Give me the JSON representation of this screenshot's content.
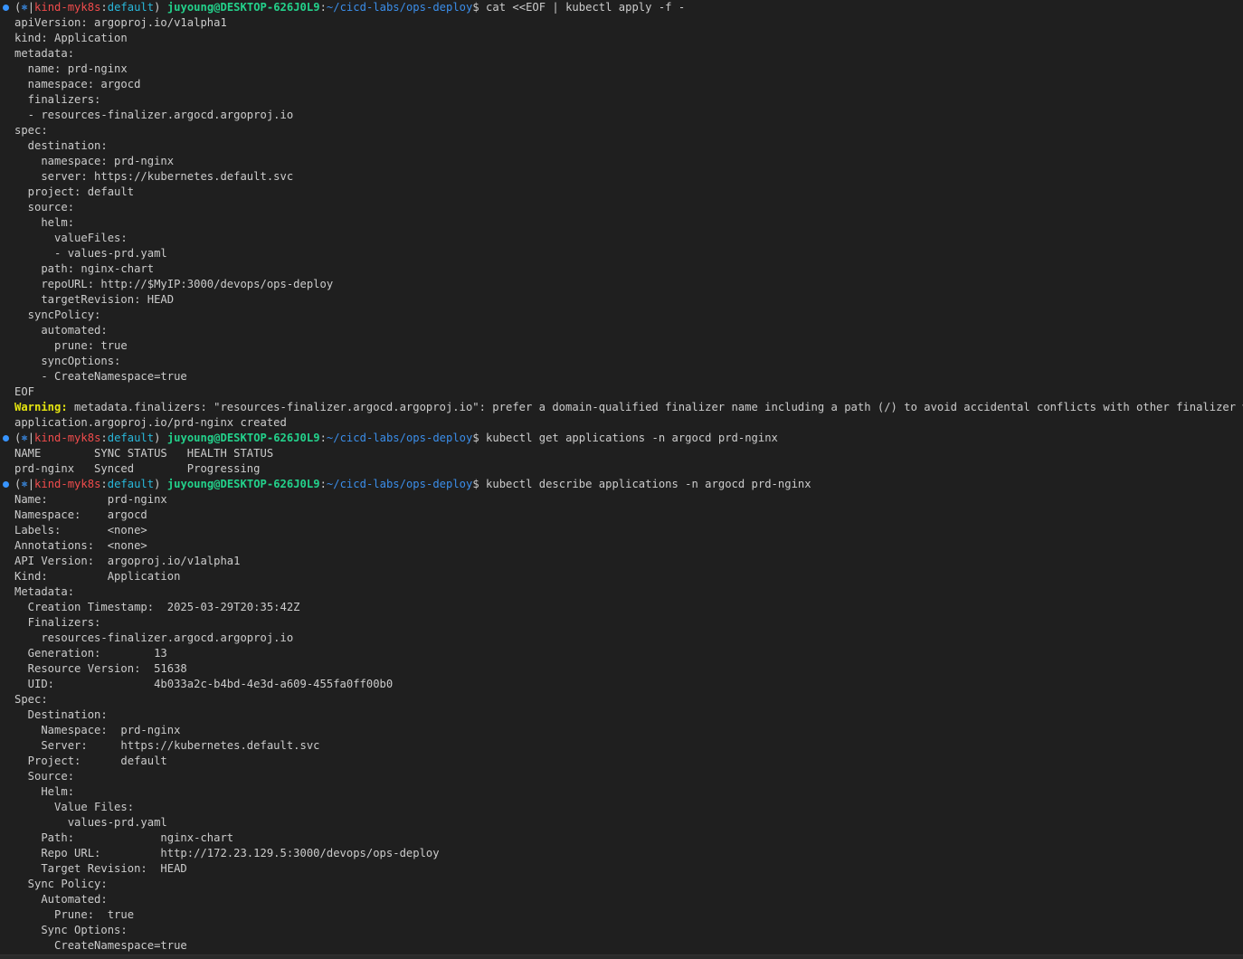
{
  "prompt": {
    "open": "(",
    "k8s_icon": "⎈",
    "sep": "|",
    "cluster": "kind-myk8s",
    "colon": ":",
    "ns": "default",
    "close": ")",
    "user_host": "juyoung@DESKTOP-626J0L9",
    "path": "~/cicd-labs/ops-deploy",
    "symbol": "$"
  },
  "blocks": [
    {
      "command": "cat <<EOF | kubectl apply -f -",
      "output": [
        {
          "text": "apiVersion: argoproj.io/v1alpha1"
        },
        {
          "text": "kind: Application"
        },
        {
          "text": "metadata:"
        },
        {
          "text": "  name: prd-nginx"
        },
        {
          "text": "  namespace: argocd"
        },
        {
          "text": "  finalizers:"
        },
        {
          "text": "  - resources-finalizer.argocd.argoproj.io"
        },
        {
          "text": "spec:"
        },
        {
          "text": "  destination:"
        },
        {
          "text": "    namespace: prd-nginx"
        },
        {
          "text": "    server: https://kubernetes.default.svc"
        },
        {
          "text": "  project: default"
        },
        {
          "text": "  source:"
        },
        {
          "text": "    helm:"
        },
        {
          "text": "      valueFiles:"
        },
        {
          "text": "      - values-prd.yaml"
        },
        {
          "text": "    path: nginx-chart"
        },
        {
          "text": "    repoURL: http://$MyIP:3000/devops/ops-deploy"
        },
        {
          "text": "    targetRevision: HEAD"
        },
        {
          "text": "  syncPolicy:"
        },
        {
          "text": "    automated:"
        },
        {
          "text": "      prune: true"
        },
        {
          "text": "    syncOptions:"
        },
        {
          "text": "    - CreateNamespace=true"
        },
        {
          "text": "EOF"
        },
        {
          "warn": "Warning:",
          "text": " metadata.finalizers: \"resources-finalizer.argocd.argoproj.io\": prefer a domain-qualified finalizer name including a path (/) to avoid accidental conflicts with other finalizer writers"
        },
        {
          "text": "application.argoproj.io/prd-nginx created"
        }
      ]
    },
    {
      "command": "kubectl get applications -n argocd prd-nginx",
      "output": [
        {
          "text": "NAME        SYNC STATUS   HEALTH STATUS"
        },
        {
          "text": "prd-nginx   Synced        Progressing"
        }
      ]
    },
    {
      "command": "kubectl describe applications -n argocd prd-nginx",
      "output": [
        {
          "text": "Name:         prd-nginx"
        },
        {
          "text": "Namespace:    argocd"
        },
        {
          "text": "Labels:       <none>"
        },
        {
          "text": "Annotations:  <none>"
        },
        {
          "text": "API Version:  argoproj.io/v1alpha1"
        },
        {
          "text": "Kind:         Application"
        },
        {
          "text": "Metadata:"
        },
        {
          "text": "  Creation Timestamp:  2025-03-29T20:35:42Z"
        },
        {
          "text": "  Finalizers:"
        },
        {
          "text": "    resources-finalizer.argocd.argoproj.io"
        },
        {
          "text": "  Generation:        13"
        },
        {
          "text": "  Resource Version:  51638"
        },
        {
          "text": "  UID:               4b033a2c-b4bd-4e3d-a609-455fa0ff00b0"
        },
        {
          "text": "Spec:"
        },
        {
          "text": "  Destination:"
        },
        {
          "text": "    Namespace:  prd-nginx"
        },
        {
          "text": "    Server:     https://kubernetes.default.svc"
        },
        {
          "text": "  Project:      default"
        },
        {
          "text": "  Source:"
        },
        {
          "text": "    Helm:"
        },
        {
          "text": "      Value Files:"
        },
        {
          "text": "        values-prd.yaml"
        },
        {
          "text": "    Path:             nginx-chart"
        },
        {
          "text": "    Repo URL:         http://172.23.129.5:3000/devops/ops-deploy"
        },
        {
          "text": "    Target Revision:  HEAD"
        },
        {
          "text": "  Sync Policy:"
        },
        {
          "text": "    Automated:"
        },
        {
          "text": "      Prune:  true"
        },
        {
          "text": "    Sync Options:"
        },
        {
          "text": "      CreateNamespace=true"
        }
      ]
    }
  ]
}
